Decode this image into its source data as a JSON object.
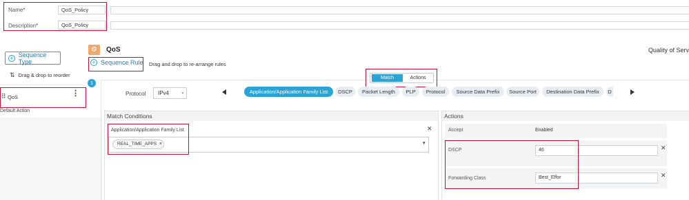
{
  "form": {
    "name_label": "Name*",
    "name_value": "QoS_Policy",
    "description_label": "Description*",
    "description_value": "QoS_Policy"
  },
  "left": {
    "sequence_type_button": "Sequence Type",
    "drag_reorder": "Drag & drop to reorder",
    "sequence_item": "QoS",
    "default_action": "Default Action"
  },
  "header": {
    "title": "QoS",
    "right_text": "Quality of Servic"
  },
  "rule": {
    "sequence_rule_button": "Sequence Rule",
    "drag_hint": "Drag and drop to re-arrange rules",
    "badge_number": "1"
  },
  "toggle": {
    "match": "Match",
    "actions": "Actions"
  },
  "protocol": {
    "label": "Protocol",
    "selected": "IPv4"
  },
  "match_pills": [
    "Application/Application Family List",
    "DSCP",
    "Packet Length",
    "PLP",
    "Protocol",
    "Source Data Prefix",
    "Source Port",
    "Destination Data Prefix",
    "D"
  ],
  "match_conditions": {
    "title": "Match Conditions",
    "field_label": "Application/Application Family List",
    "chip": "REAL_TIME_APPS"
  },
  "actions": {
    "title": "Actions",
    "accept_label": "Accept",
    "accept_value": "Enabled",
    "dscp_label": "DSCP",
    "dscp_value": "46",
    "forwarding_label": "Forwarding Class",
    "forwarding_value": "Best_Effor"
  },
  "colors": {
    "accent": "#2aa3d6",
    "highlight": "#c8102e",
    "qos_icon": "#f0a868"
  }
}
